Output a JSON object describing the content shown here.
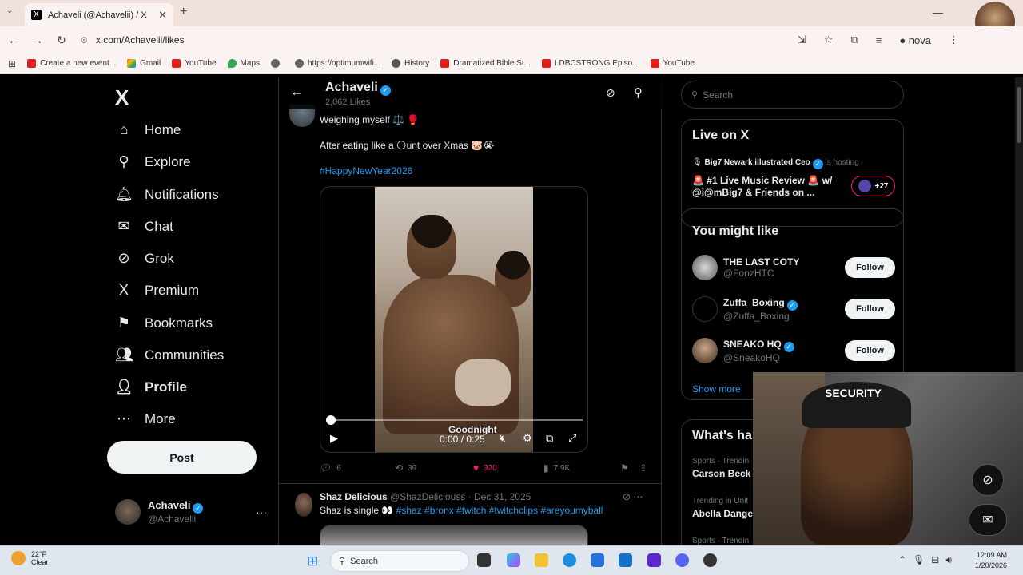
{
  "browser": {
    "tab_title": "Achaveli (@Achavelii) / X",
    "tab_favicon": "X",
    "url": "x.com/Achavelii/likes",
    "profile_name": "nova",
    "bookmarks": [
      {
        "label": "Create a new event...",
        "icon": "red"
      },
      {
        "label": "Gmail",
        "icon": "g"
      },
      {
        "label": "YouTube",
        "icon": "red"
      },
      {
        "label": "Maps",
        "icon": "maps"
      },
      {
        "label": "",
        "icon": "globe"
      },
      {
        "label": "https://optimumwifi...",
        "icon": "globe"
      },
      {
        "label": "History",
        "icon": "hist"
      },
      {
        "label": "Dramatized Bible St...",
        "icon": "red"
      },
      {
        "label": "LDBCSTRONG Episo...",
        "icon": "red"
      },
      {
        "label": "YouTube",
        "icon": "red"
      }
    ]
  },
  "nav": {
    "logo": "X",
    "items": [
      {
        "label": "Home",
        "icon": "⌂"
      },
      {
        "label": "Explore",
        "icon": "⚲"
      },
      {
        "label": "Notifications",
        "icon": "🔔︎"
      },
      {
        "label": "Chat",
        "icon": "✉"
      },
      {
        "label": "Grok",
        "icon": "⊘"
      },
      {
        "label": "Premium",
        "icon": "X"
      },
      {
        "label": "Bookmarks",
        "icon": "⚑"
      },
      {
        "label": "Communities",
        "icon": "👥︎"
      },
      {
        "label": "Profile",
        "icon": "👤︎"
      },
      {
        "label": "More",
        "icon": "⋯"
      }
    ],
    "post_label": "Post",
    "account_name": "Achaveli",
    "account_handle": "@Achavelii",
    "account_menu": "···"
  },
  "feed": {
    "header_title": "Achaveli",
    "header_sub": "2,062 Likes",
    "back": "←",
    "tweet1": {
      "line1": "Weighing myself ⚖️ 🥊",
      "line2": "After eating like a 🌕unt over Xmas 🐷😭",
      "hashtag": "#HappyNewYear2026",
      "caption": "Goodnight",
      "time": "0:00 / 0:25",
      "replies": "6",
      "reposts": "39",
      "likes": "320",
      "views": "7.9K"
    },
    "tweet2": {
      "name": "Shaz Delicious",
      "handle": "@ShazDeliciouss",
      "date": "· Dec 31, 2025",
      "text": "Shaz is single 👀",
      "hashtags": "#shaz #bronx #twitch #twitchclips #areyoumyball"
    }
  },
  "right": {
    "search_placeholder": "Search",
    "live": {
      "title": "Live on X",
      "host": "Big7 Newark illustrated Ceo",
      "hosting": "is hosting",
      "topic": "🚨 #1 Live Music Review 🚨 w/ @i@mBig7 & Friends on ...",
      "listeners": "+27"
    },
    "might_like": {
      "title": "You might like",
      "follow_label": "Follow",
      "users": [
        {
          "name": "THE LAST COTY",
          "handle": "@FonzHTC"
        },
        {
          "name": "Zuffa_Boxing",
          "handle": "@Zuffa_Boxing"
        },
        {
          "name": "SNEAKO HQ",
          "handle": "@SneakoHQ"
        }
      ],
      "show_more": "Show more"
    },
    "happening": {
      "title": "What's happenin",
      "trends": [
        {
          "cat": "Sports · Trendin",
          "name": "Carson Beck"
        },
        {
          "cat": "Trending in Unit",
          "name": "Abella Danger"
        },
        {
          "cat": "Sports · Trendin",
          "name": ""
        }
      ]
    }
  },
  "cam": {
    "hat_text": "SECURITY"
  },
  "taskbar": {
    "temp": "22°F",
    "condition": "Clear",
    "search": "Search",
    "time": "12:09 AM",
    "date": "1/20/2026"
  }
}
